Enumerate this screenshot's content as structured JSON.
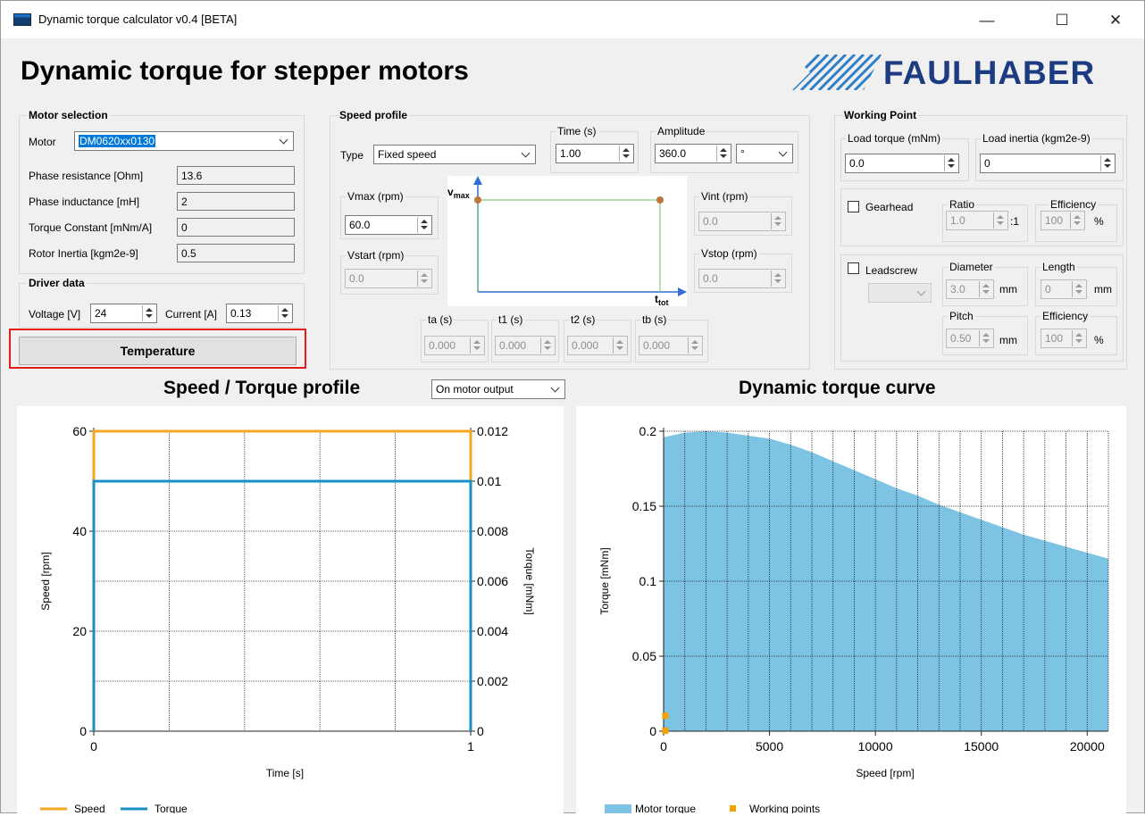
{
  "window": {
    "title": "Dynamic torque calculator v0.4 [BETA]",
    "minimize": "—",
    "maximize": "☐",
    "close": "✕"
  },
  "header": {
    "title": "Dynamic torque for stepper motors",
    "logo_text": "FAULHABER"
  },
  "motor_selection": {
    "title": "Motor selection",
    "motor_label": "Motor",
    "motor_value": "DM0620xx0130",
    "fields": [
      {
        "label": "Phase resistance [Ohm]",
        "value": "13.6"
      },
      {
        "label": "Phase inductance [mH]",
        "value": "2"
      },
      {
        "label": "Torque Constant [mNm/A]",
        "value": "0"
      },
      {
        "label": "Rotor Inertia [kgm2e-9]",
        "value": "0.5"
      }
    ]
  },
  "driver_data": {
    "title": "Driver data",
    "voltage_label": "Voltage [V]",
    "voltage_value": "24",
    "current_label": "Current [A]",
    "current_value": "0.13"
  },
  "temperature_button": "Temperature",
  "speed_profile": {
    "title": "Speed profile",
    "type_label": "Type",
    "type_value": "Fixed speed",
    "time_label": "Time (s)",
    "time_value": "1.00",
    "amplitude_label": "Amplitude",
    "amplitude_value": "360.0",
    "amplitude_unit": "°",
    "vmax_label": "Vmax (rpm)",
    "vmax_value": "60.0",
    "vstart_label": "Vstart (rpm)",
    "vstart_value": "0.0",
    "vint_label": "Vint (rpm)",
    "vint_value": "0.0",
    "vstop_label": "Vstop (rpm)",
    "vstop_value": "0.0",
    "diagram_vmax": "v",
    "diagram_vmax_sub": "max",
    "diagram_ttot": "t",
    "diagram_ttot_sub": "tot",
    "ta_label": "ta (s)",
    "ta_value": "0.000",
    "t1_label": "t1 (s)",
    "t1_value": "0.000",
    "t2_label": "t2 (s)",
    "t2_value": "0.000",
    "tb_label": "tb (s)",
    "tb_value": "0.000"
  },
  "working_point": {
    "title": "Working Point",
    "load_torque_label": "Load torque (mNm)",
    "load_torque_value": "0.0",
    "load_inertia_label": "Load inertia (kgm2e-9)",
    "load_inertia_value": "0",
    "gearhead_label": "Gearhead",
    "ratio_label": "Ratio",
    "ratio_value": "1.0",
    "ratio_unit": ":1",
    "gear_eff_label": "Efficiency",
    "gear_eff_value": "100",
    "gear_eff_unit": "%",
    "leadscrew_label": "Leadscrew",
    "diameter_label": "Diameter",
    "diameter_value": "3.0",
    "diameter_unit": "mm",
    "length_label": "Length",
    "length_value": "0",
    "length_unit": "mm",
    "pitch_label": "Pitch",
    "pitch_value": "0.50",
    "pitch_unit": "mm",
    "screw_eff_label": "Efficiency",
    "screw_eff_value": "100",
    "screw_eff_unit": "%"
  },
  "speed_torque_title": "Speed / Torque profile",
  "output_select_value": "On motor output",
  "dynamic_curve_title": "Dynamic torque curve",
  "colors": {
    "speed": "#f5a623",
    "torque": "#1a8fc4",
    "area": "#7dc3e3",
    "working_point": "#f5a000"
  },
  "chart_data": [
    {
      "type": "line",
      "title": "Speed / Torque profile",
      "xlabel": "Time [s]",
      "ylabel": "Speed [rpm]",
      "y2label": "Torque [mNm]",
      "xlim": [
        0,
        1
      ],
      "ylim": [
        0,
        60
      ],
      "y2lim": [
        0,
        0.012
      ],
      "x_ticks": [
        "0",
        "1"
      ],
      "y_ticks": [
        "0",
        "20",
        "40",
        "60"
      ],
      "y2_ticks": [
        "0",
        "0.002",
        "0.004",
        "0.006",
        "0.008",
        "0.01",
        "0.012"
      ],
      "grid": true,
      "legend": "bottom-left",
      "series": [
        {
          "name": "Speed",
          "axis": "left",
          "x": [
            0,
            0,
            1,
            1
          ],
          "y": [
            0,
            60,
            60,
            0
          ]
        },
        {
          "name": "Torque",
          "axis": "right",
          "x": [
            0,
            0,
            1,
            1
          ],
          "y": [
            0,
            0.01,
            0.01,
            0
          ]
        }
      ]
    },
    {
      "type": "area",
      "title": "Dynamic torque curve",
      "xlabel": "Speed [rpm]",
      "ylabel": "Torque [mNm]",
      "xlim": [
        0,
        21000
      ],
      "ylim": [
        0,
        0.2
      ],
      "x_ticks": [
        "0",
        "5000",
        "10000",
        "15000",
        "20000"
      ],
      "y_ticks": [
        "0",
        "0.05",
        "0.1",
        "0.15",
        "0.2"
      ],
      "grid": true,
      "legend": "bottom-left",
      "series": [
        {
          "name": "Motor torque",
          "x": [
            0,
            1000,
            2000,
            3000,
            4000,
            5000,
            6000,
            7000,
            8000,
            9000,
            10000,
            11000,
            12000,
            13000,
            14000,
            15000,
            16000,
            17000,
            18000,
            19000,
            20000,
            21000
          ],
          "y": [
            0.196,
            0.199,
            0.2,
            0.199,
            0.197,
            0.195,
            0.191,
            0.186,
            0.18,
            0.174,
            0.168,
            0.162,
            0.157,
            0.151,
            0.146,
            0.141,
            0.136,
            0.131,
            0.127,
            0.123,
            0.119,
            0.115
          ]
        },
        {
          "name": "Working points",
          "x": [
            60,
            60
          ],
          "y": [
            0,
            0.01
          ]
        }
      ]
    }
  ]
}
